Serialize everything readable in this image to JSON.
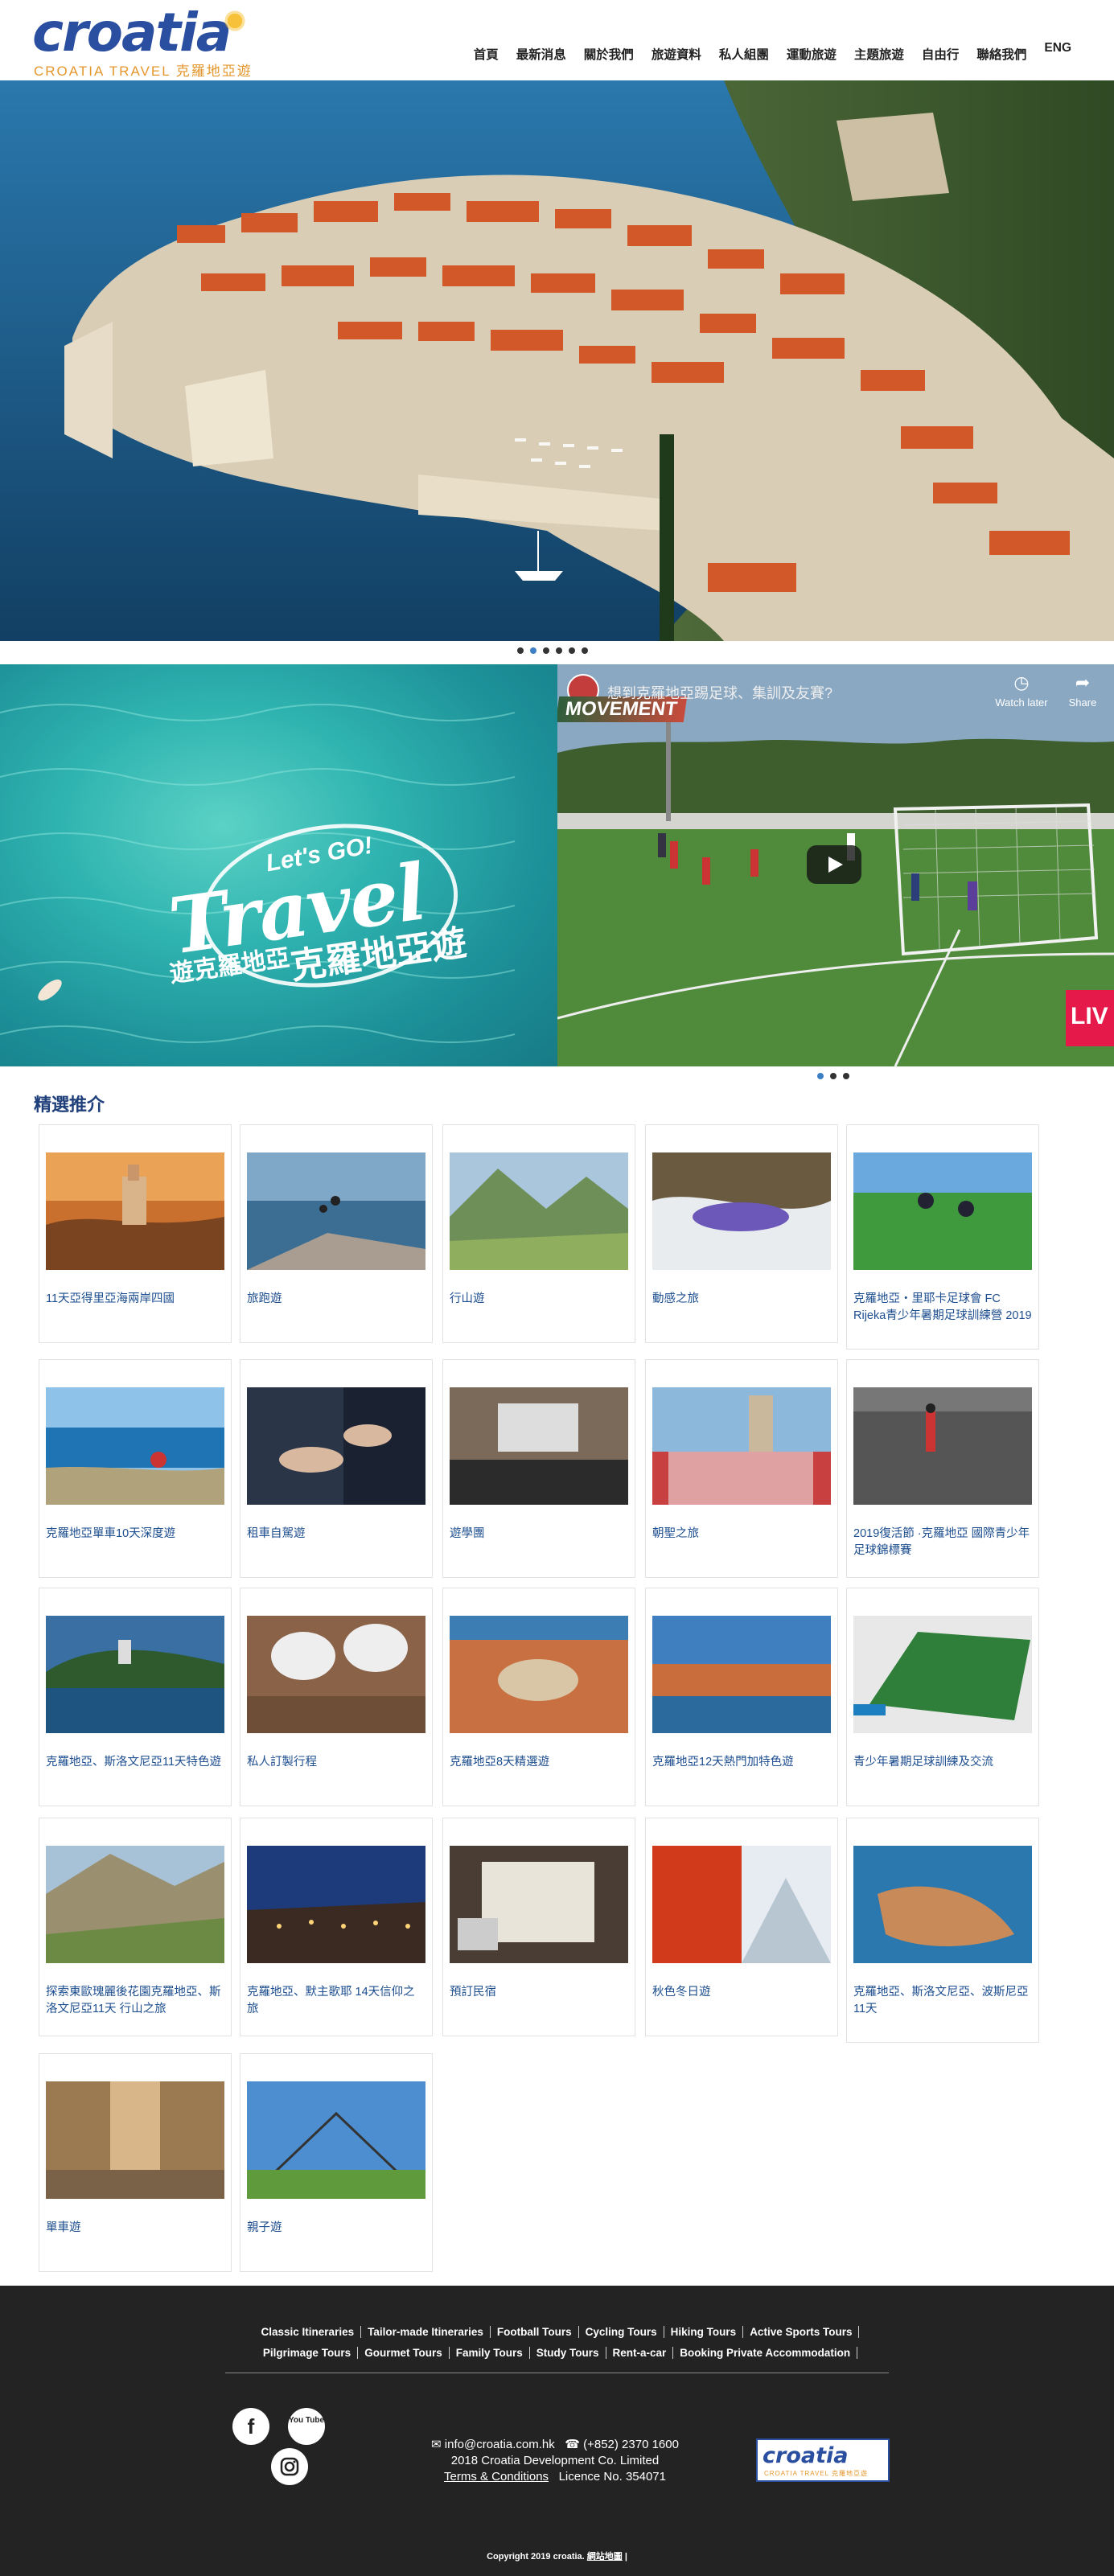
{
  "header": {
    "logo_word": "croatia",
    "logo_subtitle": "CROATIA TRAVEL 克羅地亞遊",
    "nav": [
      "首頁",
      "最新消息",
      "關於我們",
      "旅遊資料",
      "私人組團",
      "運動旅遊",
      "主題旅遊",
      "自由行",
      "聯絡我們"
    ],
    "lang": "ENG"
  },
  "banner": {
    "lets_go": "Let's GO!",
    "travel": "Travel",
    "sub_small": "遊克羅地亞",
    "sub_big": "克羅地亞遊"
  },
  "video": {
    "title": "想到克羅地亞踢足球、集訓及友賽?",
    "watch_later": "Watch later",
    "share": "Share",
    "live": "LIV",
    "movement": "MOVEMENT"
  },
  "featured": {
    "title": "精選推介",
    "cards": [
      {
        "label": "11天亞得里亞海兩岸四國"
      },
      {
        "label": "旅跑遊"
      },
      {
        "label": "行山遊"
      },
      {
        "label": "動感之旅"
      },
      {
        "label": "克羅地亞・里耶卡足球會 FC Rijeka青少年暑期足球訓練營 2019"
      },
      {
        "label": "克羅地亞單車10天深度遊"
      },
      {
        "label": "租車自駕遊"
      },
      {
        "label": "遊學團"
      },
      {
        "label": "朝聖之旅"
      },
      {
        "label": "2019復活節 ·克羅地亞 國際青少年足球錦標賽"
      },
      {
        "label": "克羅地亞、斯洛文尼亞11天特色遊"
      },
      {
        "label": "私人訂製行程"
      },
      {
        "label": "克羅地亞8天精選遊"
      },
      {
        "label": "克羅地亞12天熱門加特色遊"
      },
      {
        "label": "青少年暑期足球訓練及交流"
      },
      {
        "label": "探索東歐瑰麗後花園克羅地亞、斯洛文尼亞11天 行山之旅"
      },
      {
        "label": "克羅地亞、默主歌耶 14天信仰之旅"
      },
      {
        "label": "預訂民宿"
      },
      {
        "label": "秋色冬日遊"
      },
      {
        "label": "克羅地亞、斯洛文尼亞、波斯尼亞11天"
      },
      {
        "label": "單車遊"
      },
      {
        "label": "親子遊"
      }
    ]
  },
  "footer": {
    "links_row1": [
      "Classic Itineraries",
      "Tailor-made Itineraries",
      "Football Tours",
      "Cycling Tours",
      "Hiking Tours",
      "Active Sports Tours"
    ],
    "links_row2": [
      "Pilgrimage Tours",
      "Gourmet Tours",
      "Family Tours",
      "Study Tours",
      "Rent-a-car",
      "Booking Private Accommodation"
    ],
    "social_facebook": "f",
    "social_youtube": "You Tube",
    "email": "info@croatia.com.hk",
    "phone": "(+852) 2370 1600",
    "company": "2018 Croatia Development Co. Limited",
    "terms": "Terms & Conditions",
    "licence": "Licence No. 354071",
    "logo_word": "croatia",
    "logo_sub": "CROATIA TRAVEL 克羅地亞遊",
    "copyright": "Copyright 2019 croatia.",
    "sitemap": "網站地圖"
  },
  "colors": {
    "brand_blue": "#2a4ea0",
    "brand_orange": "#e4972c",
    "link_blue": "#1d4e8f",
    "footer_bg": "#232323"
  }
}
